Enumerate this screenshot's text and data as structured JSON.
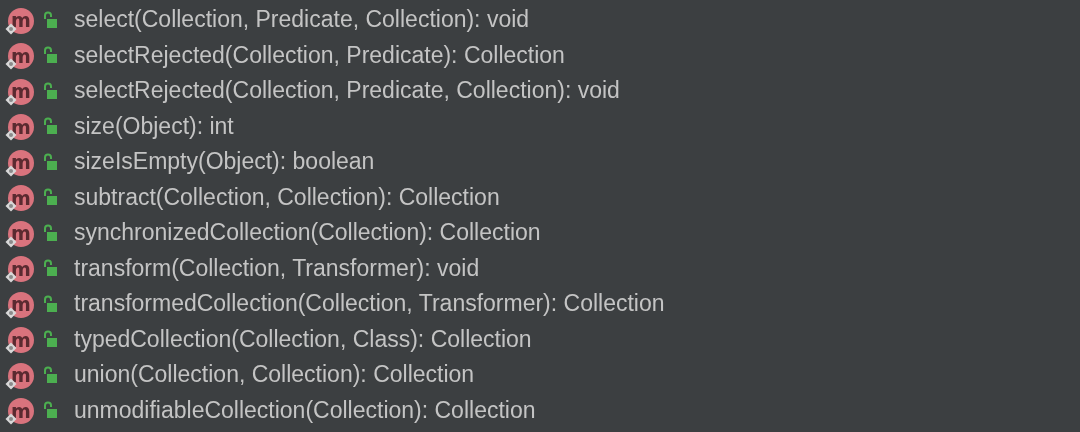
{
  "members": [
    {
      "badge": "m",
      "signature": "select(Collection, Predicate, Collection): void"
    },
    {
      "badge": "m",
      "signature": "selectRejected(Collection, Predicate): Collection"
    },
    {
      "badge": "m",
      "signature": "selectRejected(Collection, Predicate, Collection): void"
    },
    {
      "badge": "m",
      "signature": "size(Object): int"
    },
    {
      "badge": "m",
      "signature": "sizeIsEmpty(Object): boolean"
    },
    {
      "badge": "m",
      "signature": "subtract(Collection, Collection): Collection"
    },
    {
      "badge": "m",
      "signature": "synchronizedCollection(Collection): Collection"
    },
    {
      "badge": "m",
      "signature": "transform(Collection, Transformer): void"
    },
    {
      "badge": "m",
      "signature": "transformedCollection(Collection, Transformer): Collection"
    },
    {
      "badge": "m",
      "signature": "typedCollection(Collection, Class): Collection"
    },
    {
      "badge": "m",
      "signature": "union(Collection, Collection): Collection"
    },
    {
      "badge": "m",
      "signature": "unmodifiableCollection(Collection): Collection"
    }
  ]
}
